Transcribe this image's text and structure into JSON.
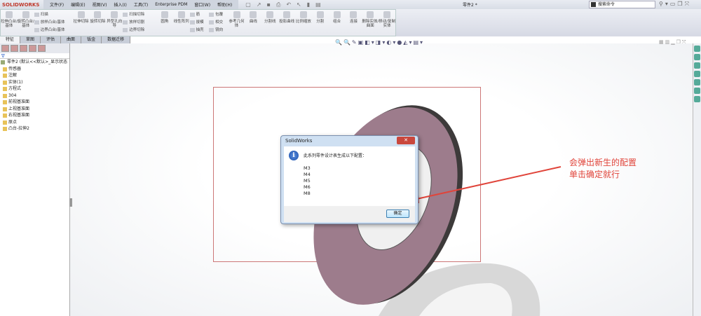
{
  "app": {
    "logo": "SOLIDWORKS",
    "doc_title": "零件2 *",
    "search_placeholder": "搜索命令"
  },
  "menu": [
    "文件(F)",
    "编辑(E)",
    "视图(V)",
    "插入(I)",
    "工具(T)",
    "Enterprise PDM",
    "窗口(W)",
    "帮助(H)"
  ],
  "ribbon": {
    "big1": [
      "拉伸凸台/基体",
      "旋转凸台/基体"
    ],
    "col1": [
      "扫描",
      "放样凸台/基体",
      "边界凸台/基体"
    ],
    "big2": [
      "拉伸切除",
      "旋转切除",
      "异型孔向导"
    ],
    "col2": [
      "扫描切除",
      "放样切割",
      "边界切除"
    ],
    "big3": [
      "圆角",
      "线性阵列"
    ],
    "col3": [
      "筋",
      "拔模",
      "抽壳"
    ],
    "col4": [
      "包覆",
      "相交",
      "镜向"
    ],
    "big4": [
      "参考几何体",
      "曲线",
      "分割线",
      "投影曲线",
      "比例缩放",
      "分割",
      "组合",
      "连接",
      "删除实体/曲面",
      "移动/复制实体"
    ]
  },
  "tabs": [
    "特征",
    "草图",
    "评估",
    "曲面",
    "钣金",
    "数据迁移"
  ],
  "tree": {
    "root": "零件2 (默认<<默认>_显示状态",
    "items": [
      "传感器",
      "注解",
      "实体(1)",
      "方程式",
      "304",
      "前视基准面",
      "上视基准面",
      "右视基准面",
      "原点",
      "凸台-拉伸2"
    ]
  },
  "dialog": {
    "title": "SolidWorks",
    "close": "✕",
    "message": "此系列零件设计表生成以下配置：",
    "configs": [
      "M3",
      "M4",
      "M5",
      "M6",
      "M8"
    ],
    "ok": "确定"
  },
  "annotation": {
    "line1": "会弹出新生的配置",
    "line2": "单击确定就行",
    "color": "#e0443a"
  }
}
